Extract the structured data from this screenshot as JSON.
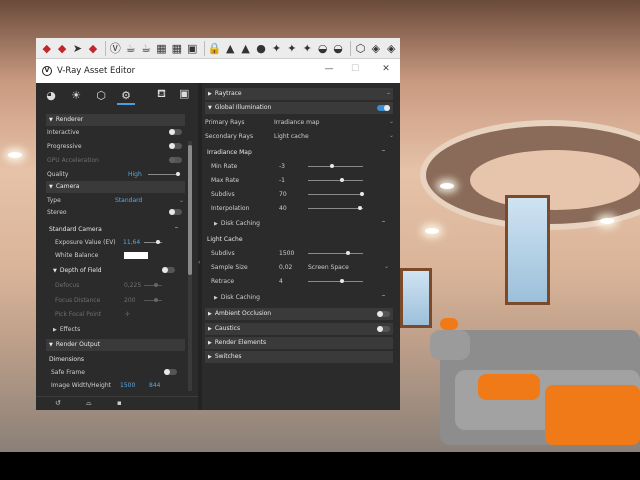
{
  "toolbar": {
    "icons": [
      "ruby-icon",
      "ruby-icon",
      "cursor-icon",
      "ruby-icon",
      "vray-icon",
      "teapot-icon",
      "teapot-icon",
      "render-icon",
      "render-icon",
      "frame-icon",
      "lock-icon",
      "cap-icon",
      "cap-icon",
      "sphere-icon",
      "light-icon",
      "light-icon",
      "light-icon",
      "dome-icon",
      "dome-icon",
      "mesh-icon",
      "layers-icon",
      "layers-icon"
    ]
  },
  "window": {
    "title": "V-Ray Asset Editor",
    "logo": "V",
    "minimize": "—",
    "maximize": "☐",
    "close": "✕"
  },
  "tabs": [
    "material-icon",
    "light-icon",
    "geometry-icon",
    "settings-icon",
    "teapot-icon",
    "frame-icon"
  ],
  "left": {
    "renderer": {
      "header": "Renderer",
      "interactive": "Interactive",
      "progressive": "Progressive",
      "gpu": "GPU Acceleration",
      "quality": "Quality",
      "quality_value": "High"
    },
    "camera": {
      "header": "Camera",
      "type": "Type",
      "type_value": "Standard",
      "stereo": "Stereo"
    },
    "standard_camera": {
      "header": "Standard Camera",
      "exposure": "Exposure Value (EV)",
      "exposure_value": "11,64",
      "white_balance": "White Balance",
      "white_balance_color": "#ffffff"
    },
    "dof": {
      "header": "Depth of Field",
      "defocus": "Defocus",
      "defocus_value": "0,225",
      "focus_distance": "Focus Distance",
      "focus_distance_value": "200",
      "pick": "Pick Focal Point"
    },
    "effects": "Effects",
    "render_output": {
      "header": "Render Output",
      "dimensions": "Dimensions",
      "safe_frame": "Safe Frame",
      "image_wh": "Image Width/Height",
      "width": "1500",
      "height": "844"
    }
  },
  "right": {
    "raytrace": "Raytrace",
    "gi": {
      "header": "Global Illumination",
      "primary": "Primary Rays",
      "primary_value": "Irradiance map",
      "secondary": "Secondary Rays",
      "secondary_value": "Light cache"
    },
    "irradiance": {
      "header": "Irradiance Map",
      "min_rate": "Min Rate",
      "min_rate_value": "-3",
      "max_rate": "Max Rate",
      "max_rate_value": "-1",
      "subdivs": "Subdivs",
      "subdivs_value": "70",
      "interp": "Interpolation",
      "interp_value": "40",
      "disk": "Disk Caching"
    },
    "lightcache": {
      "header": "Light Cache",
      "subdivs": "Subdivs",
      "subdivs_value": "1500",
      "sample": "Sample Size",
      "sample_value": "0,02",
      "sample_mode": "Screen Space",
      "retrace": "Retrace",
      "retrace_value": "4",
      "disk": "Disk Caching"
    },
    "ao": "Ambient Occlusion",
    "caustics": "Caustics",
    "render_elements": "Render Elements",
    "switches": "Switches"
  },
  "colors": {
    "accent": "#3b8fd0",
    "panel": "#2b2b2b",
    "header": "#3a3a3a"
  }
}
